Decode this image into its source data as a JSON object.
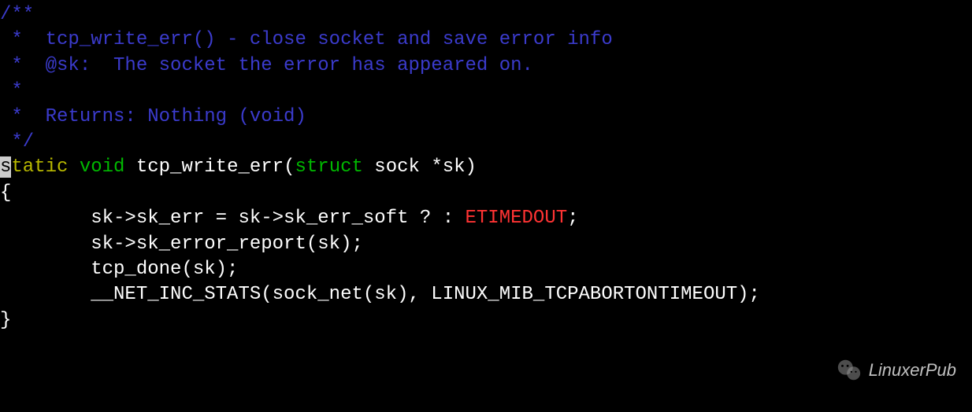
{
  "comment": {
    "line1": "/**",
    "line2": " *  tcp_write_err() - close socket and save error info",
    "line3": " *  @sk:  The socket the error has appeared on.",
    "line4": " *",
    "line5": " *  Returns: Nothing (void)",
    "line6": " */"
  },
  "blank1": "",
  "signature": {
    "cursor_char": "s",
    "static_kw": "tatic",
    "void_kw": "void",
    "fn_name": "tcp_write_err(",
    "struct_kw": "struct",
    "rest": " sock *sk)"
  },
  "body": {
    "open_brace": "{",
    "line1_pre": "        sk->sk_err = sk->sk_err_soft ? : ",
    "line1_macro": "ETIMEDOUT",
    "line1_post": ";",
    "line2": "        sk->sk_error_report(sk);",
    "blank2": "",
    "line3": "        tcp_done(sk);",
    "line4": "        __NET_INC_STATS(sock_net(sk), LINUX_MIB_TCPABORTONTIMEOUT);",
    "close_brace": "}"
  },
  "watermark_text": "LinuxerPub"
}
